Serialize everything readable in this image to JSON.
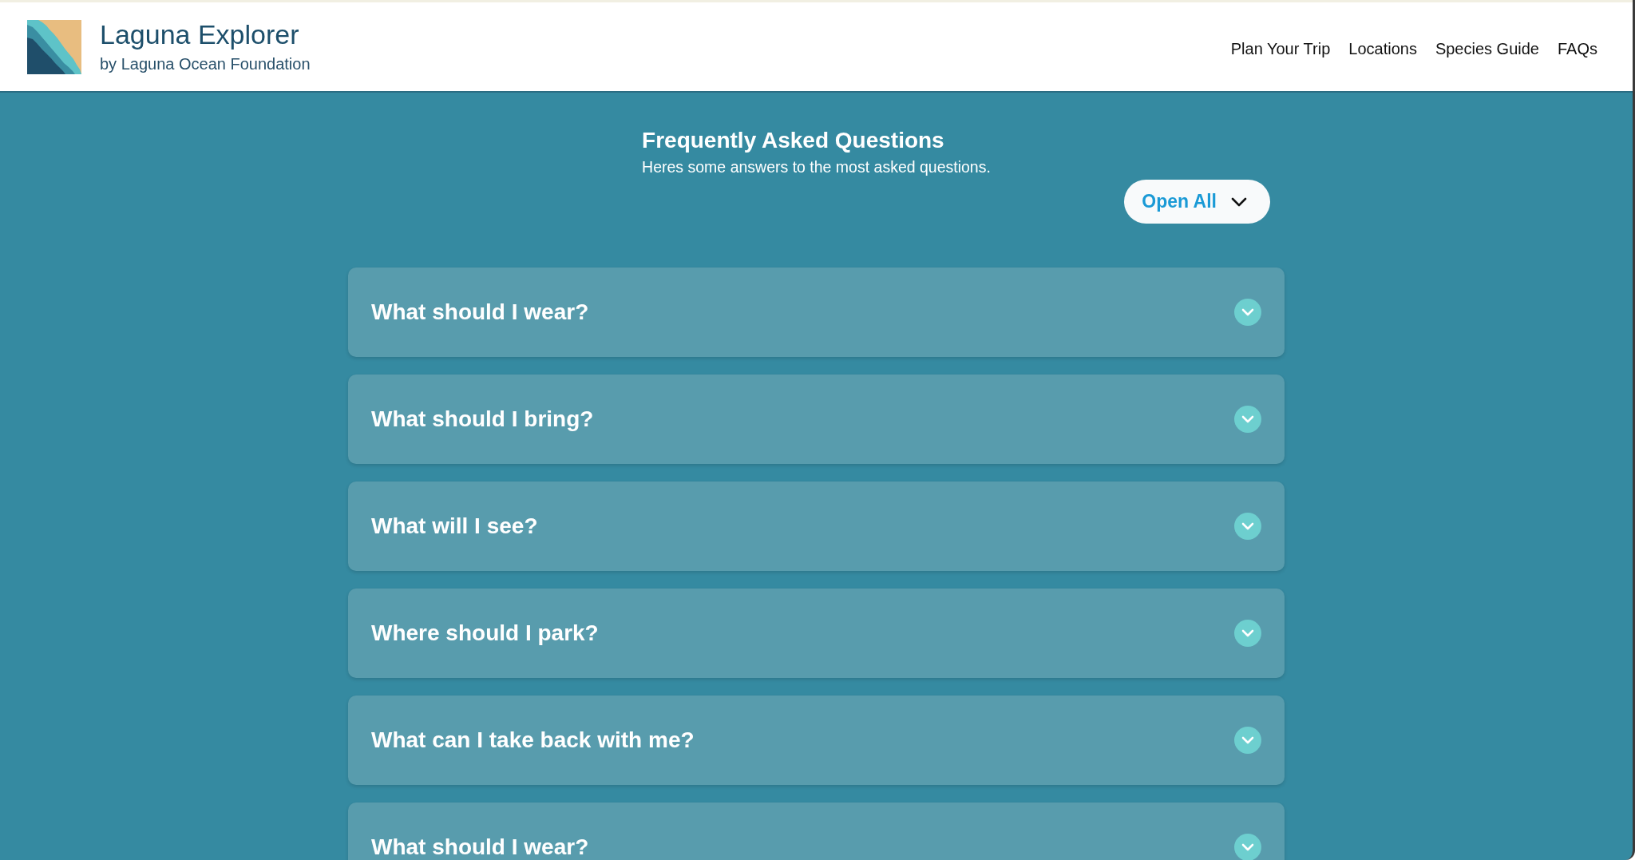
{
  "header": {
    "title": "Laguna Explorer",
    "subtitle": "by Laguna Ocean Foundation",
    "nav": [
      {
        "label": "Plan Your Trip"
      },
      {
        "label": "Locations"
      },
      {
        "label": "Species Guide"
      },
      {
        "label": "FAQs"
      }
    ]
  },
  "faq": {
    "title": "Frequently Asked Questions",
    "subtitle": "Heres some answers to the most asked questions.",
    "open_all_button": "Open All",
    "questions": [
      {
        "question": "What should I wear?",
        "expanded": false
      },
      {
        "question": "What should I bring?",
        "expanded": false
      },
      {
        "question": "What will I see?",
        "expanded": false
      },
      {
        "question": "Where should I park?",
        "expanded": false
      },
      {
        "question": "What can I take back with me?",
        "expanded": false
      },
      {
        "question": "What should I wear?",
        "expanded": false
      }
    ]
  }
}
